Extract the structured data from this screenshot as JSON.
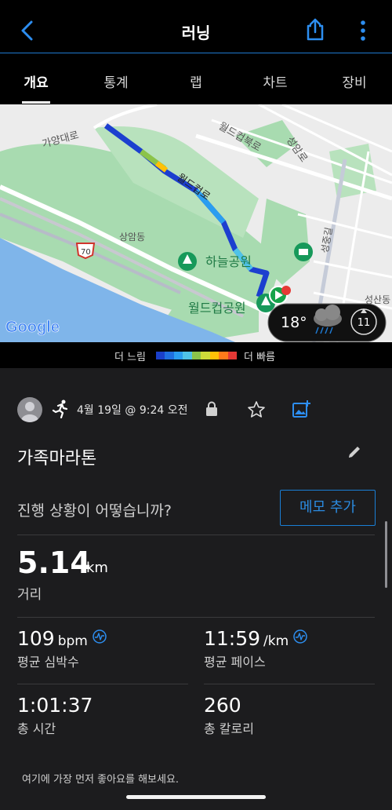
{
  "header": {
    "title": "러닝",
    "back_icon": "chevron-left-icon",
    "share_icon": "share-icon",
    "more_icon": "more-vertical-icon",
    "accent": "#1f7ad1"
  },
  "tabs": [
    {
      "label": "개요",
      "active": true
    },
    {
      "label": "통계",
      "active": false
    },
    {
      "label": "랩",
      "active": false
    },
    {
      "label": "차트",
      "active": false
    },
    {
      "label": "장비",
      "active": false
    }
  ],
  "map": {
    "labels": {
      "gayangdaero": "가양대로",
      "worldcupbukro": "월드컵북로",
      "seongamro": "성암로",
      "worldcupro": "월드컵로",
      "sangamdong": "상암동",
      "haneul_park": "하늘공원",
      "worldcup_park": "월드컵공원",
      "seongjung_gil": "성중길",
      "seongsan_dong": "성산동",
      "route_70": "70"
    },
    "brand": "Google",
    "weather": {
      "temp": "18°",
      "icon": "rain-cloud-icon",
      "wind": "11"
    }
  },
  "legend": {
    "slow": "더 느림",
    "fast": "더 빠름",
    "colors": [
      "#1a3fc9",
      "#1f6fe0",
      "#2a9df0",
      "#4fc3e8",
      "#8bc34a",
      "#cddc39",
      "#ffc107",
      "#ff7a1a",
      "#e53935"
    ]
  },
  "activity": {
    "datetime": "4월 19일 @ 9:24 오전",
    "name": "가족마라톤",
    "prompt": "진행 상황이 어떻습니까?",
    "memo_button": "메모 추가",
    "distance": {
      "value": "5.14",
      "unit": "km",
      "label": "거리"
    },
    "heart_rate": {
      "value": "109",
      "unit": "bpm",
      "label": "평균 심박수"
    },
    "pace": {
      "value": "11:59",
      "unit": "/km",
      "label": "평균 페이스"
    },
    "time": {
      "value": "1:01:37",
      "label": "총 시간"
    },
    "calories": {
      "value": "260",
      "label": "총 칼로리"
    },
    "like_prompt": "여기에 가장 먼저 좋아요를 해보세요."
  }
}
